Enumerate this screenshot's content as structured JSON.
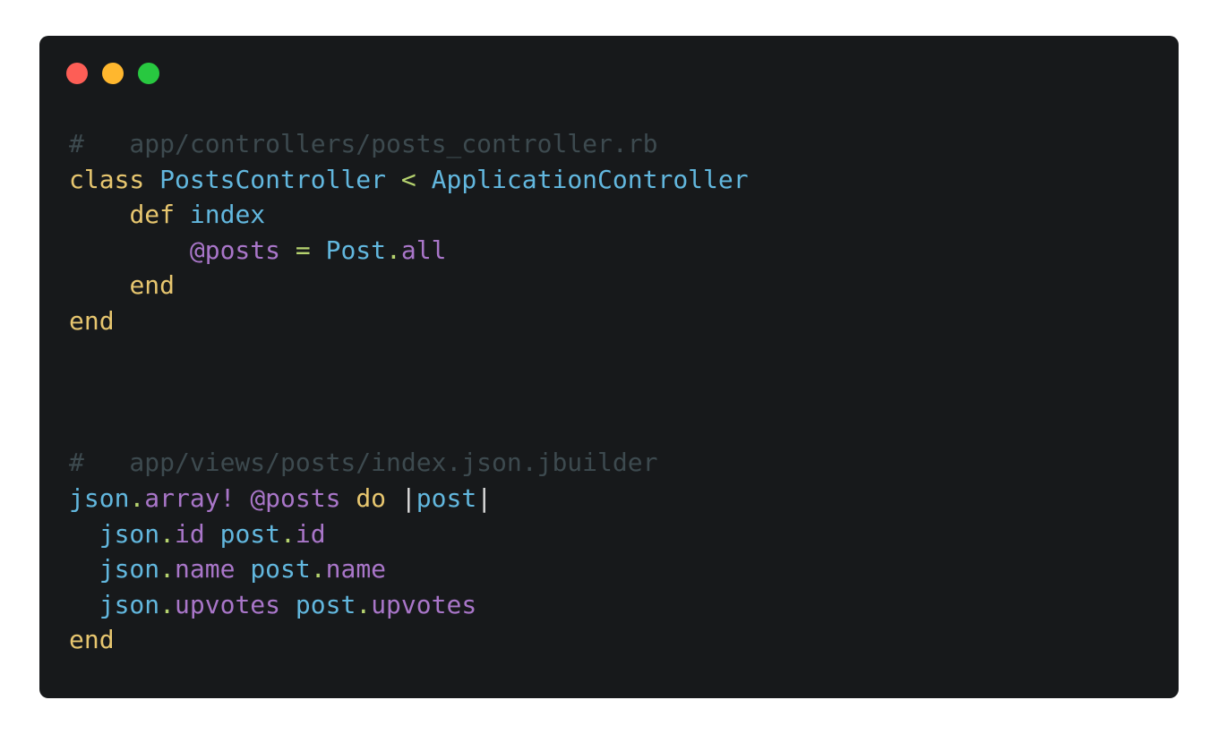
{
  "window": {
    "traffic_lights": [
      {
        "name": "close",
        "color": "#fd5e56"
      },
      {
        "name": "minimize",
        "color": "#ffb72e"
      },
      {
        "name": "maximize",
        "color": "#28c840"
      }
    ]
  },
  "code": {
    "lines": [
      [
        {
          "t": "#   app/controllers/posts_controller.rb",
          "c": "cmt"
        }
      ],
      [
        {
          "t": "class",
          "c": "kw"
        },
        {
          "t": " ",
          "c": "plain"
        },
        {
          "t": "PostsController",
          "c": "cls"
        },
        {
          "t": " ",
          "c": "plain"
        },
        {
          "t": "<",
          "c": "op"
        },
        {
          "t": " ",
          "c": "plain"
        },
        {
          "t": "ApplicationController",
          "c": "cls"
        }
      ],
      [
        {
          "t": "    ",
          "c": "plain"
        },
        {
          "t": "def",
          "c": "kw"
        },
        {
          "t": " ",
          "c": "plain"
        },
        {
          "t": "index",
          "c": "cls"
        }
      ],
      [
        {
          "t": "        ",
          "c": "plain"
        },
        {
          "t": "@posts",
          "c": "ivar"
        },
        {
          "t": " ",
          "c": "plain"
        },
        {
          "t": "=",
          "c": "op"
        },
        {
          "t": " ",
          "c": "plain"
        },
        {
          "t": "Post",
          "c": "cls"
        },
        {
          "t": ".",
          "c": "op"
        },
        {
          "t": "all",
          "c": "meth"
        }
      ],
      [
        {
          "t": "    ",
          "c": "plain"
        },
        {
          "t": "end",
          "c": "kw"
        }
      ],
      [
        {
          "t": "end",
          "c": "kw"
        }
      ],
      [],
      [],
      [],
      [
        {
          "t": "#   app/views/posts/index.json.jbuilder",
          "c": "cmt"
        }
      ],
      [
        {
          "t": "json",
          "c": "cls"
        },
        {
          "t": ".",
          "c": "op"
        },
        {
          "t": "array!",
          "c": "meth"
        },
        {
          "t": " ",
          "c": "plain"
        },
        {
          "t": "@posts",
          "c": "ivar"
        },
        {
          "t": " ",
          "c": "plain"
        },
        {
          "t": "do",
          "c": "kw"
        },
        {
          "t": " ",
          "c": "plain"
        },
        {
          "t": "|",
          "c": "plain"
        },
        {
          "t": "post",
          "c": "cls"
        },
        {
          "t": "|",
          "c": "plain"
        }
      ],
      [
        {
          "t": "  ",
          "c": "plain"
        },
        {
          "t": "json",
          "c": "cls"
        },
        {
          "t": ".",
          "c": "op"
        },
        {
          "t": "id",
          "c": "meth"
        },
        {
          "t": " ",
          "c": "plain"
        },
        {
          "t": "post",
          "c": "cls"
        },
        {
          "t": ".",
          "c": "op"
        },
        {
          "t": "id",
          "c": "meth"
        }
      ],
      [
        {
          "t": "  ",
          "c": "plain"
        },
        {
          "t": "json",
          "c": "cls"
        },
        {
          "t": ".",
          "c": "op"
        },
        {
          "t": "name",
          "c": "meth"
        },
        {
          "t": " ",
          "c": "plain"
        },
        {
          "t": "post",
          "c": "cls"
        },
        {
          "t": ".",
          "c": "op"
        },
        {
          "t": "name",
          "c": "meth"
        }
      ],
      [
        {
          "t": "  ",
          "c": "plain"
        },
        {
          "t": "json",
          "c": "cls"
        },
        {
          "t": ".",
          "c": "op"
        },
        {
          "t": "upvotes",
          "c": "meth"
        },
        {
          "t": " ",
          "c": "plain"
        },
        {
          "t": "post",
          "c": "cls"
        },
        {
          "t": ".",
          "c": "op"
        },
        {
          "t": "upvotes",
          "c": "meth"
        }
      ],
      [
        {
          "t": "end",
          "c": "kw"
        }
      ]
    ]
  }
}
